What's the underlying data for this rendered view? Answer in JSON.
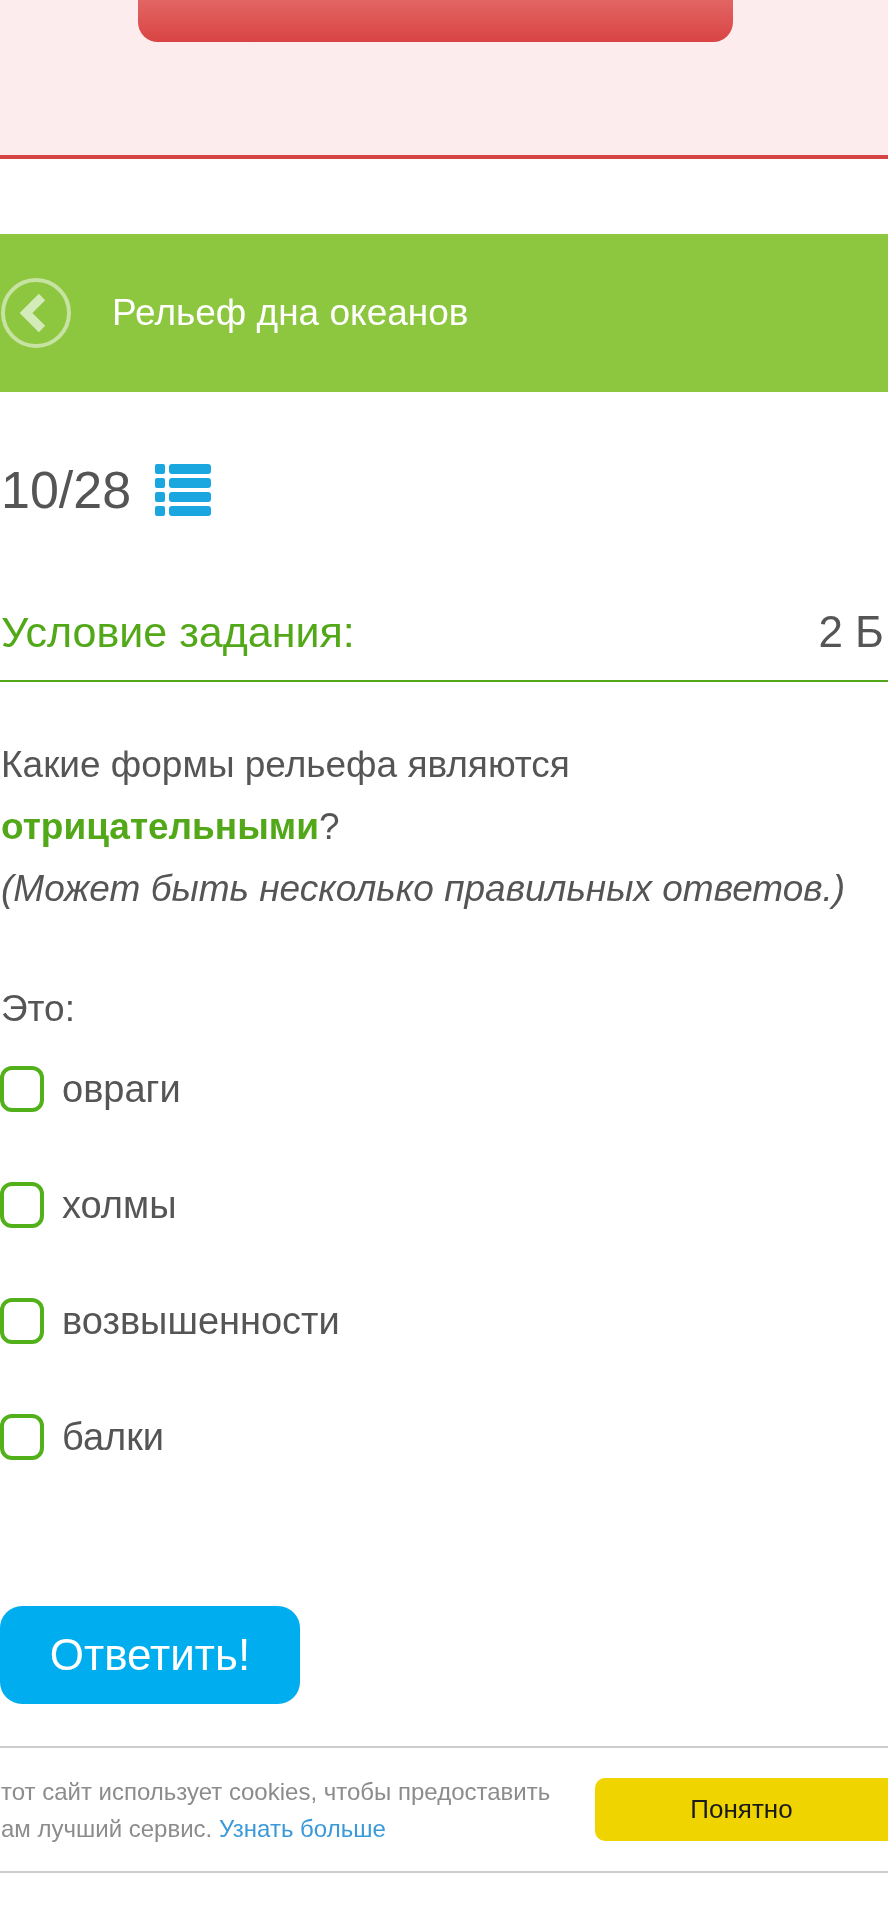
{
  "header": {
    "title": "Рельеф дна океанов"
  },
  "progress": {
    "counter": "10/28"
  },
  "task": {
    "heading": "Условие задания:",
    "points": "2 Б",
    "question": "Какие формы рельефа являются **отрицательными**?",
    "note": "(Может быть несколько правильных ответов.)",
    "prompt": "Это:"
  },
  "options": [
    {
      "label": "овраги",
      "checked": false
    },
    {
      "label": "холмы",
      "checked": false
    },
    {
      "label": "возвышенности",
      "checked": false
    },
    {
      "label": "балки",
      "checked": false
    }
  ],
  "submit_button": "Ответить!",
  "cookie_banner": {
    "text": "тот сайт использует cookies, чтобы предоставить ам лучший сервис.",
    "link": "Узнать больше",
    "button": "Понятно"
  }
}
